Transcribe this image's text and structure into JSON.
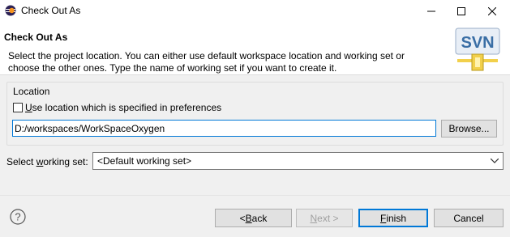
{
  "window": {
    "title": "Check Out As",
    "minimize_label": "–",
    "maximize_label": "☐",
    "close_label": "✕"
  },
  "banner": {
    "title": "Check Out As",
    "description": "Select the project location. You can either use default workspace location and working set or choose the other ones. Type the name of working set if you want to create it.",
    "logo_text": "SVN"
  },
  "location": {
    "group_label": "Location",
    "use_pref_checkbox": {
      "label_mnemonic": "U",
      "label_rest": "se location which is specified in preferences",
      "checked": false
    },
    "path_value": "D:/workspaces/WorkSpaceOxygen",
    "browse_label": "Browse..."
  },
  "working_set": {
    "label_pre": "Select ",
    "label_mnemonic": "w",
    "label_post": "orking set:",
    "selected": "<Default working set>"
  },
  "footer": {
    "back_label_pre": "< ",
    "back_mnemonic": "B",
    "back_label_post": "ack",
    "next_label_pre": "",
    "next_mnemonic": "N",
    "next_label_post": "ext >",
    "finish_mnemonic": "F",
    "finish_label_post": "inish",
    "cancel_label": "Cancel"
  },
  "colors": {
    "accent": "#0078d7",
    "svn_blue": "#3a6ea5",
    "svn_yellow": "#f2d04b"
  }
}
